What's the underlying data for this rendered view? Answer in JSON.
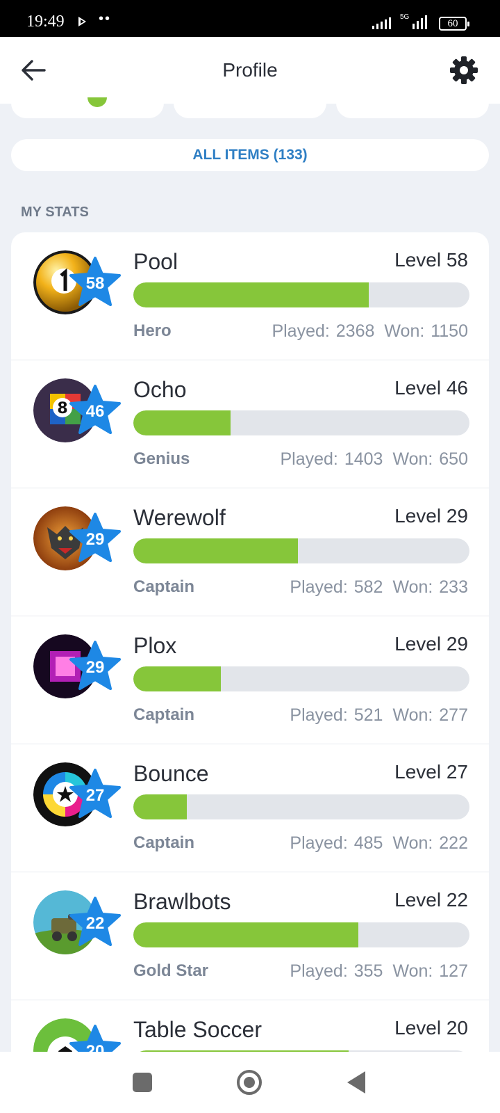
{
  "status_bar": {
    "time": "19:49",
    "dots": "••",
    "network": "5G",
    "battery": "60"
  },
  "header": {
    "title": "Profile",
    "back_icon": "arrow-left-icon",
    "settings_icon": "gear-icon"
  },
  "all_items_label": "ALL ITEMS (133)",
  "section_title": "MY STATS",
  "stats": [
    {
      "name": "Pool",
      "level_label": "Level 58",
      "badge": "58",
      "rank": "Hero",
      "played": "Played: 2368",
      "won": "Won: 1150",
      "progress": 0.7,
      "icon": "billiard-ball-icon"
    },
    {
      "name": "Ocho",
      "level_label": "Level 46",
      "badge": "46",
      "rank": "Genius",
      "played": "Played: 1403",
      "won": "Won: 650",
      "progress": 0.29,
      "icon": "ocho-card-icon"
    },
    {
      "name": "Werewolf",
      "level_label": "Level 29",
      "badge": "29",
      "rank": "Captain",
      "played": "Played: 582",
      "won": "Won: 233",
      "progress": 0.49,
      "icon": "werewolf-icon"
    },
    {
      "name": "Plox",
      "level_label": "Level 29",
      "badge": "29",
      "rank": "Captain",
      "played": "Played: 521",
      "won": "Won: 277",
      "progress": 0.26,
      "icon": "plox-square-icon"
    },
    {
      "name": "Bounce",
      "level_label": "Level 27",
      "badge": "27",
      "rank": "Captain",
      "played": "Played: 485",
      "won": "Won: 222",
      "progress": 0.16,
      "icon": "bounce-ring-icon"
    },
    {
      "name": "Brawlbots",
      "level_label": "Level 22",
      "badge": "22",
      "rank": "Gold Star",
      "played": "Played: 355",
      "won": "Won: 127",
      "progress": 0.67,
      "icon": "brawlbots-robot-icon"
    },
    {
      "name": "Table Soccer",
      "level_label": "Level 20",
      "badge": "20",
      "rank": "",
      "played": "",
      "won": "",
      "progress": 0.64,
      "icon": "soccer-ball-icon"
    }
  ],
  "colors": {
    "accent_green": "#86c63a",
    "star_blue": "#1e88e5",
    "link_blue": "#2f7fc4"
  }
}
